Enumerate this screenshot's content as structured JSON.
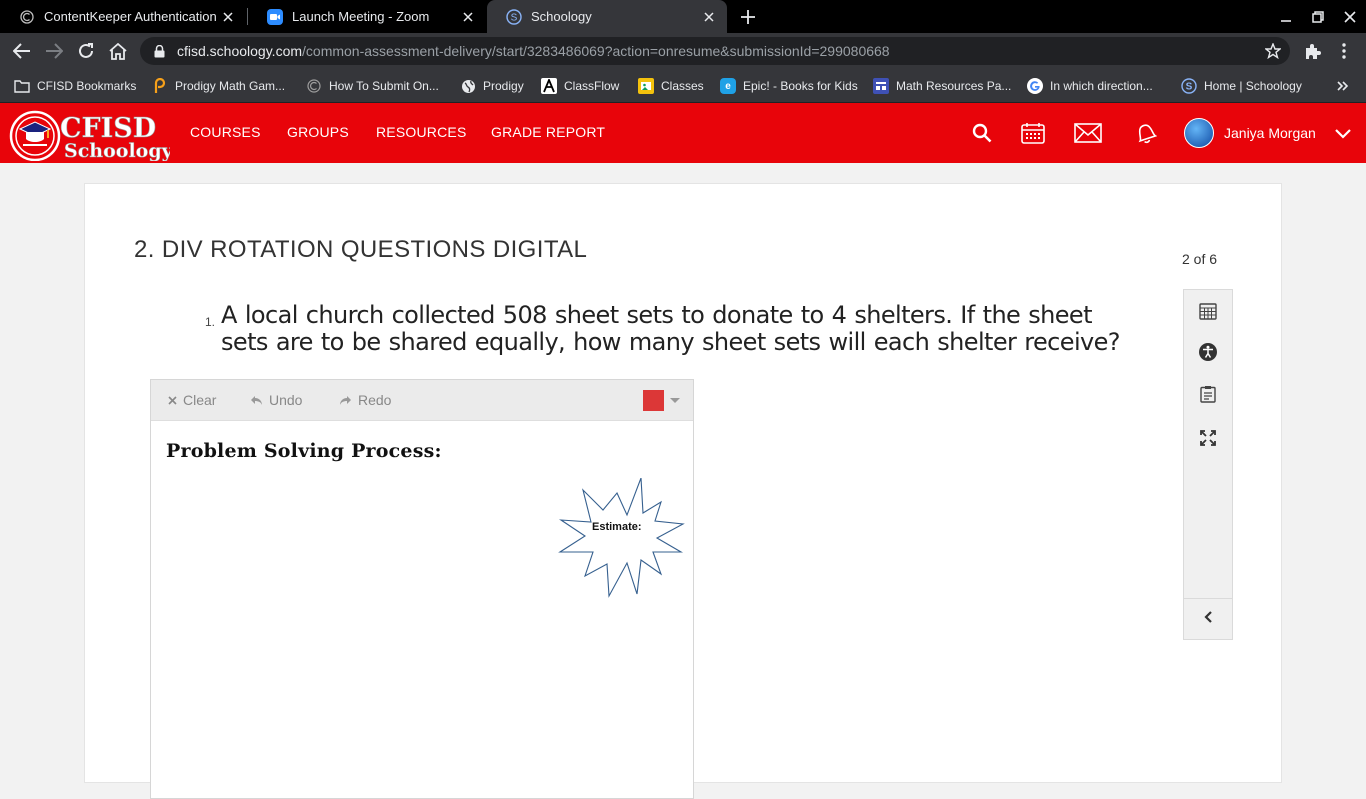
{
  "browser": {
    "tabs": [
      {
        "title": "ContentKeeper Authentication",
        "icon": "contentkeeper-icon",
        "active": false
      },
      {
        "title": "Launch Meeting - Zoom",
        "icon": "zoom-icon",
        "active": false
      },
      {
        "title": "Schoology",
        "icon": "schoology-icon",
        "active": true
      }
    ],
    "url_host": "cfisd.schoology.com",
    "url_path": "/common-assessment-delivery/start/3283486069?action=onresume&submissionId=299080668",
    "bookmarks": [
      {
        "label": "CFISD Bookmarks",
        "icon": "folder-icon"
      },
      {
        "label": "Prodigy Math Gam...",
        "icon": "prodigy-icon"
      },
      {
        "label": "How To Submit On...",
        "icon": "contentkeeper-icon"
      },
      {
        "label": "Prodigy",
        "icon": "globe-icon"
      },
      {
        "label": "ClassFlow",
        "icon": "classflow-icon"
      },
      {
        "label": "Classes",
        "icon": "classes-icon"
      },
      {
        "label": "Epic! - Books for Kids",
        "icon": "epic-icon"
      },
      {
        "label": "Math Resources Pa...",
        "icon": "math-resources-icon"
      },
      {
        "label": "In which direction...",
        "icon": "google-icon"
      },
      {
        "label": "Home | Schoology",
        "icon": "schoology-icon"
      }
    ]
  },
  "header": {
    "logo_top": "CFISD",
    "logo_bottom": "Schoology",
    "nav": [
      "COURSES",
      "GROUPS",
      "RESOURCES",
      "GRADE REPORT"
    ],
    "user_name": "Janiya Morgan",
    "colors": {
      "brand_red": "#e8040a"
    }
  },
  "assessment": {
    "title": "2. DIV ROTATION QUESTIONS DIGITAL",
    "page_count": "2 of 6",
    "question_number": "1.",
    "question_text": "A local church collected 508 sheet sets to donate to 4  shelters.  If the sheet sets are to be shared equally, how many sheet sets will each shelter receive?"
  },
  "drawing": {
    "clear_label": "Clear",
    "undo_label": "Undo",
    "redo_label": "Redo",
    "pen_color": "#dc3737",
    "heading": "Problem Solving Process:",
    "estimate_label": "Estimate:"
  }
}
